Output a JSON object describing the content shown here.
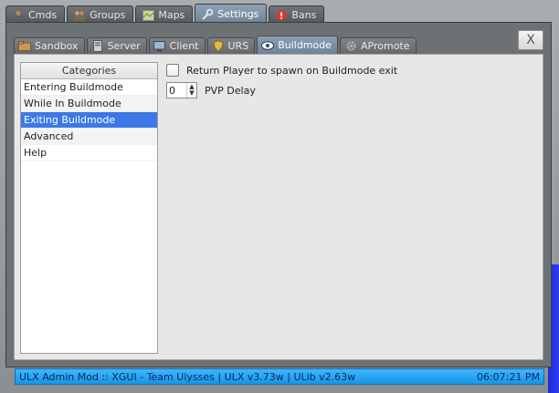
{
  "top_tabs": [
    {
      "label": "Cmds",
      "icon": "person-icon"
    },
    {
      "label": "Groups",
      "icon": "users-icon"
    },
    {
      "label": "Maps",
      "icon": "map-icon"
    },
    {
      "label": "Settings",
      "icon": "wrench-icon",
      "active": true
    },
    {
      "label": "Bans",
      "icon": "alert-icon"
    }
  ],
  "inner_tabs": [
    {
      "label": "Sandbox",
      "icon": "folder-icon"
    },
    {
      "label": "Server",
      "icon": "server-icon"
    },
    {
      "label": "Client",
      "icon": "monitor-icon"
    },
    {
      "label": "URS",
      "icon": "shield-icon"
    },
    {
      "label": "Buildmode",
      "icon": "eye-icon",
      "active": true
    },
    {
      "label": "APromote",
      "icon": "gear-icon"
    }
  ],
  "close_label": "X",
  "categories": {
    "header": "Categories",
    "items": [
      {
        "label": "Entering Buildmode"
      },
      {
        "label": "While In Buildmode"
      },
      {
        "label": "Exiting Buildmode",
        "selected": true
      },
      {
        "label": "Advanced"
      },
      {
        "label": "Help"
      }
    ]
  },
  "settings": {
    "return_spawn_label": "Return Player to spawn on Buildmode exit",
    "pvp_delay_value": "0",
    "pvp_delay_label": "PVP Delay"
  },
  "status": {
    "left": "ULX Admin Mod :: XGUI - Team Ulysses | ULX v3.73w | ULib v2.63w",
    "time": "06:07:21 PM"
  },
  "colors": {
    "selected": "#3d79e6",
    "statusbar": "#1596e6"
  }
}
